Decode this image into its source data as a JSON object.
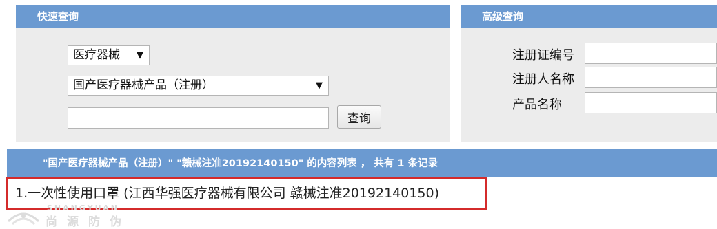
{
  "quick_search": {
    "title": "快速查询",
    "category_select": "医疗器械",
    "product_type_select": "国产医疗器械产品（注册）",
    "keyword_value": "",
    "search_button": "查询",
    "arrow": "▼"
  },
  "advanced_search": {
    "title": "高级查询",
    "fields": [
      {
        "label": "注册证编号",
        "value": ""
      },
      {
        "label": "注册人名称",
        "value": ""
      },
      {
        "label": "产品名称",
        "value": ""
      }
    ]
  },
  "results": {
    "header": "\"国产医疗器械产品（注册）\" \"赣械注准20192140150\" 的内容列表 ， 共有 1 条记录",
    "items": [
      {
        "text": "1.一次性使用口罩 (江西华强医疗器械有限公司 赣械注准20192140150)"
      }
    ]
  },
  "watermark": {
    "en": "SHANGYUAN",
    "cn": "尚源防伪"
  },
  "colors": {
    "header_blue": "#6b9ad1",
    "panel_gray": "#ececec",
    "highlight_red": "#d42b2b"
  }
}
